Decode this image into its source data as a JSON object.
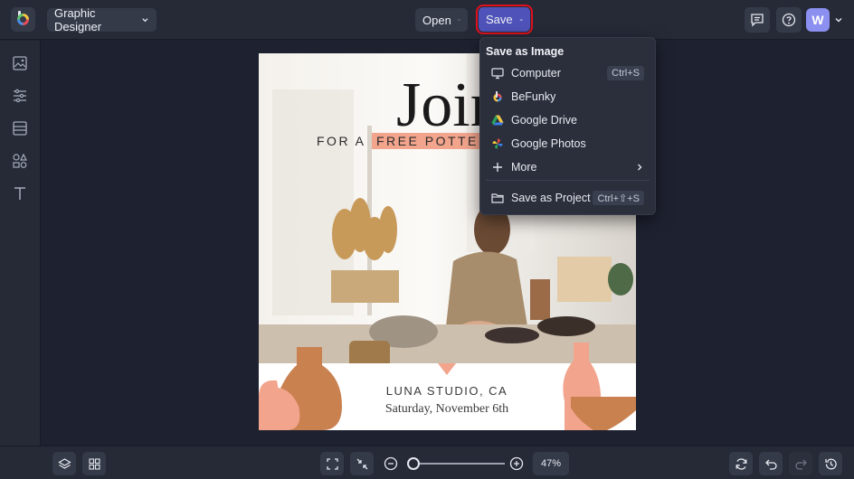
{
  "topbar": {
    "mode_label": "Graphic Designer",
    "open_label": "Open",
    "save_label": "Save",
    "avatar_initial": "W"
  },
  "save_menu": {
    "heading": "Save as Image",
    "items": [
      {
        "label": "Computer",
        "shortcut": "Ctrl+S",
        "icon": "monitor-icon"
      },
      {
        "label": "BeFunky",
        "shortcut": "",
        "icon": "befunky-logo-icon"
      },
      {
        "label": "Google Drive",
        "shortcut": "",
        "icon": "google-drive-icon"
      },
      {
        "label": "Google Photos",
        "shortcut": "",
        "icon": "google-photos-icon"
      },
      {
        "label": "More",
        "shortcut": "",
        "icon": "plus-icon"
      },
      {
        "label": "Save as Project",
        "shortcut": "Ctrl+⇧+S",
        "icon": "folder-icon"
      }
    ]
  },
  "poster": {
    "headline": "Join",
    "subline_prefix": "FOR A",
    "subline_highlight": "FREE POTTE",
    "studio": "LUNA STUDIO, CA",
    "date": "Saturday, November 6th"
  },
  "bottombar": {
    "zoom": "47%",
    "zoom_fraction": 0.05
  },
  "colors": {
    "accent": "#4f52b8",
    "highlight_outline": "#e0101e",
    "poster_accent": "#f2a48c",
    "poster_brown": "#c8814f"
  }
}
